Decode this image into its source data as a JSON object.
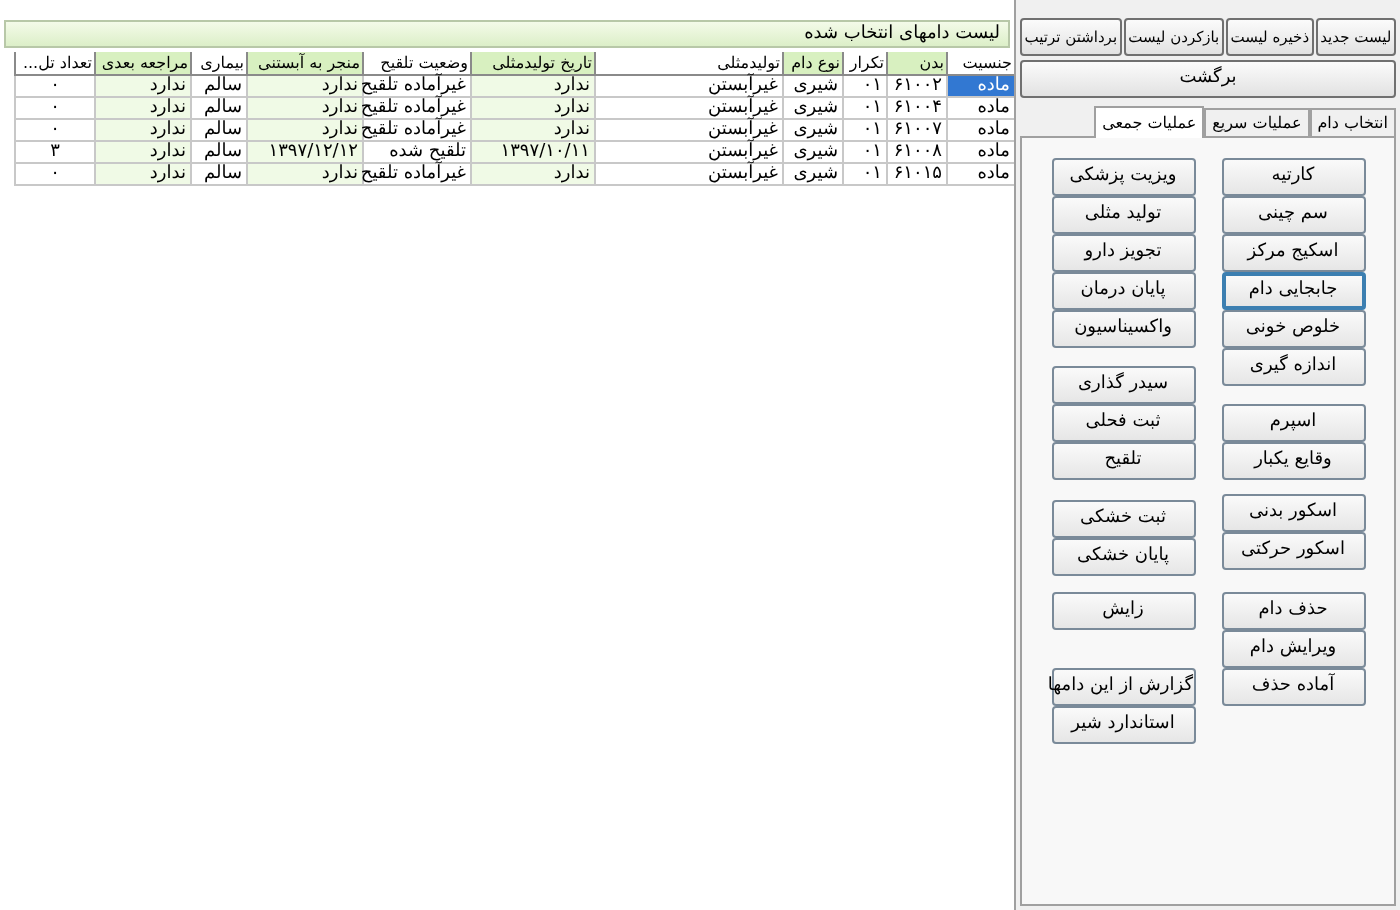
{
  "list_panel": {
    "title": "لیست دامهای انتخاب شده",
    "columns": [
      {
        "label": "جنسیت",
        "highlight": false
      },
      {
        "label": "بدن",
        "highlight": true
      },
      {
        "label": "تکرار",
        "highlight": false
      },
      {
        "label": "نوع دام",
        "highlight": true
      },
      {
        "label": "تولیدمثلی",
        "highlight": false
      },
      {
        "label": "تاریخ تولیدمثلی",
        "highlight": true
      },
      {
        "label": "وضعیت تلقیح",
        "highlight": false
      },
      {
        "label": "منجر به آبستنی",
        "highlight": true
      },
      {
        "label": "بیماری",
        "highlight": false
      },
      {
        "label": "مراجعه بعدی",
        "highlight": true
      },
      {
        "label": "تعداد تل...",
        "highlight": false
      }
    ],
    "rows": [
      {
        "selected": true,
        "cells": [
          "ماده",
          "۶۱۰۰۲",
          "۰۱",
          "شیری",
          "غیرآبستن",
          "ندارد",
          "غیرآماده تلقیح",
          "ندارد",
          "سالم",
          "ندارد",
          "۰"
        ]
      },
      {
        "selected": false,
        "cells": [
          "ماده",
          "۶۱۰۰۴",
          "۰۱",
          "شیری",
          "غیرآبستن",
          "ندارد",
          "غیرآماده تلقیح",
          "ندارد",
          "سالم",
          "ندارد",
          "۰"
        ]
      },
      {
        "selected": false,
        "cells": [
          "ماده",
          "۶۱۰۰۷",
          "۰۱",
          "شیری",
          "غیرآبستن",
          "ندارد",
          "غیرآماده تلقیح",
          "ندارد",
          "سالم",
          "ندارد",
          "۰"
        ]
      },
      {
        "selected": false,
        "cells": [
          "ماده",
          "۶۱۰۰۸",
          "۰۱",
          "شیری",
          "غیرآبستن",
          "۱۳۹۷/۱۰/۱۱",
          "تلقیح شده",
          "۱۳۹۷/۱۲/۱۲",
          "سالم",
          "ندارد",
          "۳"
        ]
      },
      {
        "selected": false,
        "cells": [
          "ماده",
          "۶۱۰۱۵",
          "۰۱",
          "شیری",
          "غیرآبستن",
          "ندارد",
          "غیرآماده تلقیح",
          "ندارد",
          "سالم",
          "ندارد",
          "۰"
        ]
      }
    ]
  },
  "toolbar": [
    "لیست جدید",
    "ذخیره لیست",
    "بازکردن لیست",
    "برداشتن ترتیب"
  ],
  "back_button": "برگشت",
  "tabs": [
    {
      "label": "انتخاب دام",
      "selected": false
    },
    {
      "label": "عملیات سریع",
      "selected": false
    },
    {
      "label": "عملیات جمعی",
      "selected": true
    }
  ],
  "action_columns": [
    {
      "groups": [
        [
          {
            "label": "کارتیه",
            "focused": false
          },
          {
            "label": "سم چینی",
            "focused": false
          },
          {
            "label": "اسکیج مرکز",
            "focused": false
          },
          {
            "label": "جابجایی دام",
            "focused": true
          },
          {
            "label": "خلوص خونی",
            "focused": false
          },
          {
            "label": "اندازه گیری",
            "focused": false
          }
        ],
        [
          {
            "label": "اسپرم",
            "focused": false
          },
          {
            "label": "وقایع یکبار",
            "focused": false
          }
        ],
        [
          {
            "label": "اسکور بدنی",
            "focused": false
          },
          {
            "label": "اسکور حرکتی",
            "focused": false
          }
        ],
        [
          {
            "label": "حذف دام",
            "focused": false
          },
          {
            "label": "ویرایش دام",
            "focused": false
          },
          {
            "label": "آماده حذف",
            "focused": false
          }
        ]
      ]
    },
    {
      "groups": [
        [
          {
            "label": "ویزیت پزشکی",
            "focused": false
          },
          {
            "label": "تولید مثلی",
            "focused": false
          },
          {
            "label": "تجویز دارو",
            "focused": false
          },
          {
            "label": "پایان درمان",
            "focused": false
          },
          {
            "label": "واکسیناسیون",
            "focused": false
          }
        ],
        [
          {
            "label": "سیدر گذاری",
            "focused": false
          },
          {
            "label": "ثبت فحلی",
            "focused": false
          },
          {
            "label": "تلقیح",
            "focused": false
          }
        ],
        [
          {
            "label": "ثبت خشکی",
            "focused": false
          },
          {
            "label": "پایان خشکی",
            "focused": false
          }
        ],
        [
          {
            "label": "زایش",
            "focused": false
          }
        ],
        [
          {
            "label": "گزارش از این دامها",
            "focused": false
          },
          {
            "label": "استاندارد شیر",
            "focused": false
          }
        ]
      ]
    }
  ]
}
